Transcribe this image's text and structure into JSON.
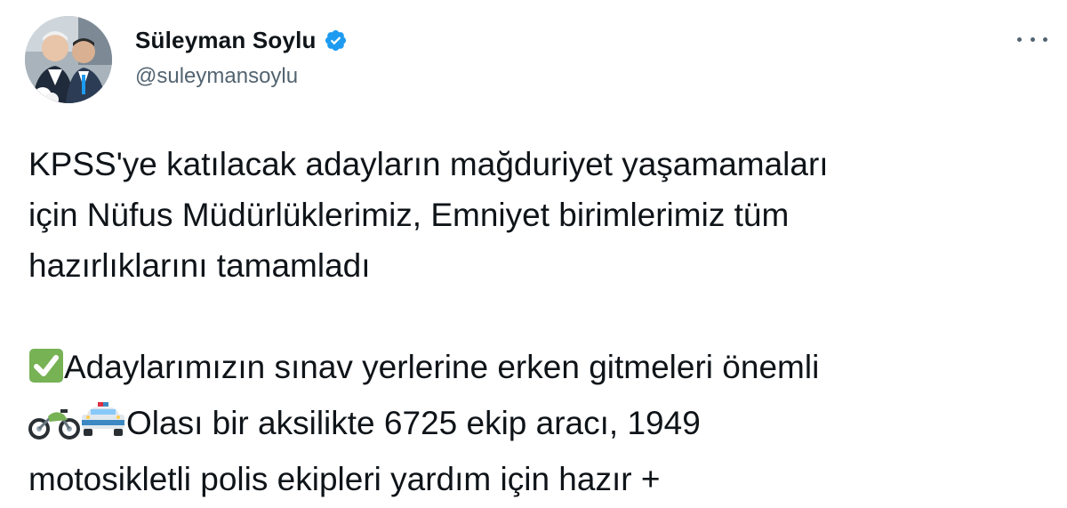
{
  "author": {
    "display_name": "Süleyman Soylu",
    "handle": "@suleymansoylu",
    "verified": true
  },
  "menu": {
    "icon": "more-horizontal-icon"
  },
  "tweet": {
    "paragraph1": [
      "KPSS'ye katılacak adayların mağduriyet yaşamamaları",
      "için Nüfus Müdürlüklerimiz, Emniyet birimlerimiz tüm",
      "hazırlıklarını tamamladı"
    ],
    "paragraph2": {
      "line1_emoji": "check-mark-button-emoji",
      "line1_text": "Adaylarımızın sınav yerlerine erken gitmeleri önemli",
      "line2_emojis": [
        "motorcycle-emoji",
        "police-car-emoji"
      ],
      "line2_text": "Olası bir aksilikte 6725 ekip aracı, 1949",
      "line3_text": "motosikletli polis ekipleri yardım için hazır +"
    }
  },
  "colors": {
    "text": "#0f1419",
    "secondary_text": "#536471",
    "verified_badge": "#1d9bf0",
    "check_emoji": "#77b255"
  }
}
